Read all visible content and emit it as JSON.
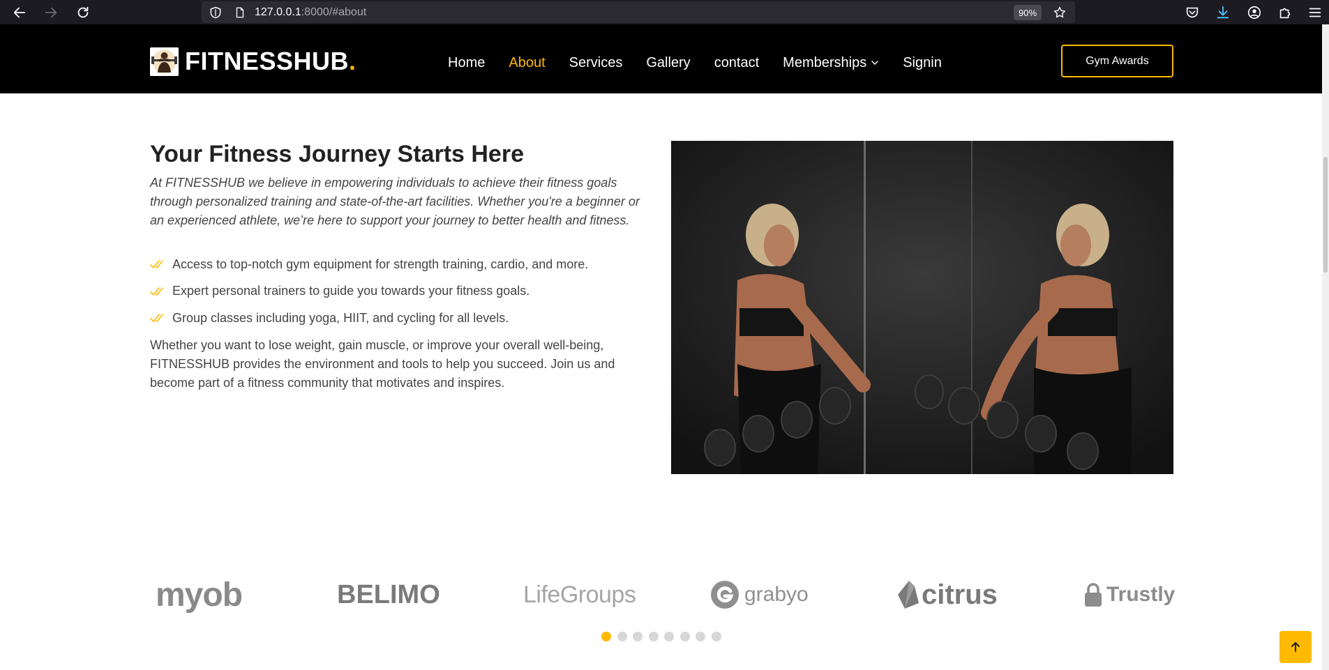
{
  "browser": {
    "url_host": "127.0.0.1",
    "url_rest": ":8000/#about",
    "zoom": "90%"
  },
  "header": {
    "logo_text": "FITNESSHUB",
    "logo_dot": ".",
    "nav": [
      "Home",
      "About",
      "Services",
      "Gallery",
      "contact",
      "Memberships",
      "Signin"
    ],
    "active_nav": "About",
    "cta": "Gym Awards"
  },
  "about": {
    "title": "Your Fitness Journey Starts Here",
    "intro": "At FITNESSHUB we believe in empowering individuals to achieve their fitness goals through personalized training and state-of-the-art facilities. Whether you're a beginner or an experienced athlete, we’re here to support your journey to better health and fitness.",
    "features": [
      "Access to top-notch gym equipment for strength training, cardio, and more.",
      "Expert personal trainers to guide you towards your fitness goals.",
      "Group classes including yoga, HIIT, and cycling for all levels."
    ],
    "outro": "Whether you want to lose weight, gain muscle, or improve your overall well-being, FITNESSHUB provides the environment and tools to help you succeed. Join us and become part of a fitness community that motivates and inspires."
  },
  "clients": {
    "logos": [
      "myob",
      "BELIMO",
      "LifeGroups",
      "grabyo",
      "citrus",
      "Trustly"
    ],
    "pagination_count": 8,
    "active_page": 1
  },
  "colors": {
    "accent": "#feb900",
    "header_bg": "#000000",
    "text": "#444444",
    "heading": "#222222",
    "logo_gray": "#8c8c8c"
  },
  "icons": {
    "back": "arrow-left-icon",
    "forward": "arrow-right-icon",
    "reload": "reload-icon",
    "shield": "shield-icon",
    "page": "page-icon",
    "bookmark": "star-icon",
    "pocket": "pocket-icon",
    "download": "download-icon",
    "account": "account-icon",
    "extensions": "puzzle-icon",
    "menu": "hamburger-icon",
    "check": "double-check-icon",
    "back_to_top": "arrow-up-icon"
  }
}
